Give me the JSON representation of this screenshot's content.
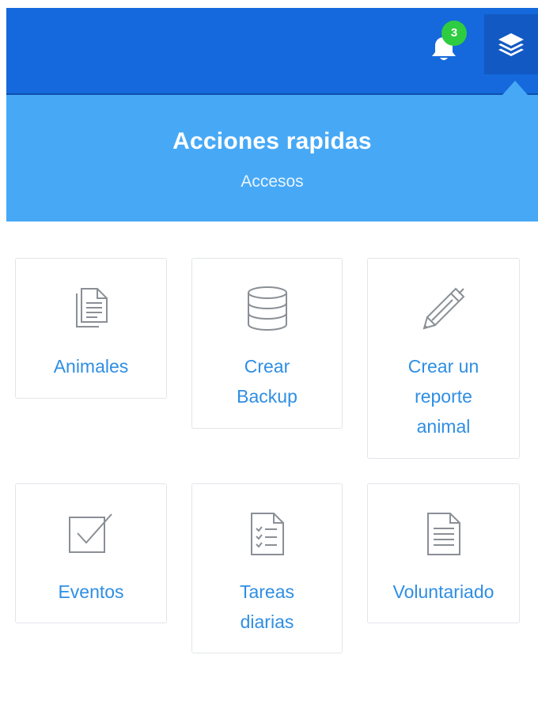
{
  "topbar": {
    "notifications": {
      "icon": "bell-icon",
      "count": "3"
    },
    "quick_actions_button": {
      "icon": "layers-icon"
    }
  },
  "panel": {
    "title": "Acciones rapidas",
    "subtitle": "Accesos"
  },
  "tiles": [
    {
      "icon": "documents-icon",
      "label_lines": [
        "Animales"
      ]
    },
    {
      "icon": "database-icon",
      "label_lines": [
        "Crear",
        "Backup"
      ]
    },
    {
      "icon": "pen-icon",
      "label_lines": [
        "Crear un",
        "reporte",
        "animal"
      ]
    },
    {
      "icon": "checkbox-icon",
      "label_lines": [
        "Eventos"
      ]
    },
    {
      "icon": "checklist-icon",
      "label_lines": [
        "Tareas",
        "diarias"
      ]
    },
    {
      "icon": "document-icon",
      "label_lines": [
        "Voluntariado"
      ]
    }
  ],
  "colors": {
    "topbar": "#1569dc",
    "panel_header": "#47a9f6",
    "badge": "#2ecc40",
    "tile_label": "#2e8ee3",
    "icon_stroke": "#8a8f96"
  }
}
